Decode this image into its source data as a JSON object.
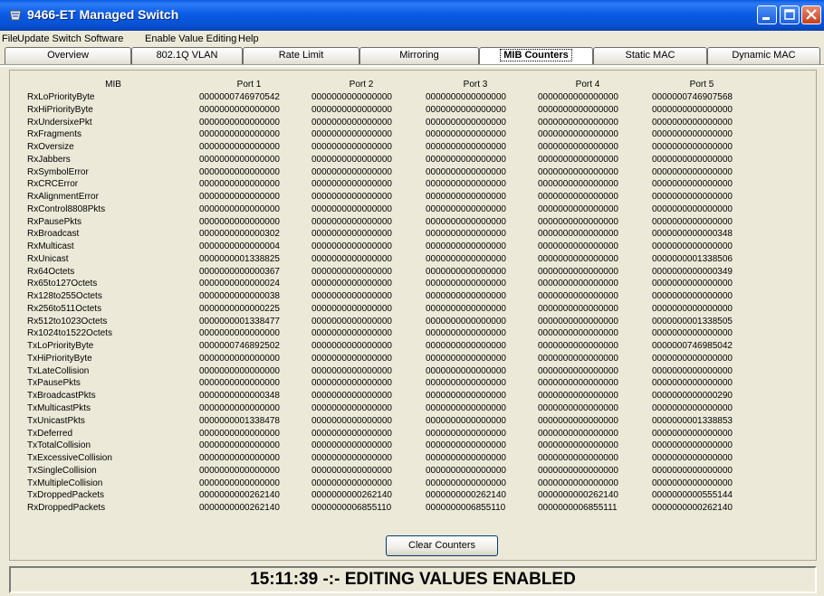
{
  "window": {
    "title": "9466-ET Managed Switch",
    "icon": "switch-app-icon",
    "controls": [
      "minimize-icon",
      "maximize-icon",
      "close-icon"
    ]
  },
  "menu": [
    "File",
    "Update Switch Software",
    "Enable Value Editing",
    "Help"
  ],
  "tabs": [
    {
      "label": "Overview",
      "active": false
    },
    {
      "label": "802.1Q VLAN",
      "active": false
    },
    {
      "label": "Rate Limit",
      "active": false
    },
    {
      "label": "Mirroring",
      "active": false
    },
    {
      "label": "MIB Counters",
      "active": true
    },
    {
      "label": "Static MAC",
      "active": false
    },
    {
      "label": "Dynamic MAC",
      "active": false
    }
  ],
  "table": {
    "headers": [
      "MIB",
      "Port 1",
      "Port 2",
      "Port 3",
      "Port 4",
      "Port 5"
    ],
    "rows": [
      [
        "RxLoPriorityByte",
        "0000000746970542",
        "0000000000000000",
        "0000000000000000",
        "0000000000000000",
        "0000000746907568"
      ],
      [
        "RxHiPriorityByte",
        "0000000000000000",
        "0000000000000000",
        "0000000000000000",
        "0000000000000000",
        "0000000000000000"
      ],
      [
        "RxUndersixePkt",
        "0000000000000000",
        "0000000000000000",
        "0000000000000000",
        "0000000000000000",
        "0000000000000000"
      ],
      [
        "RxFragments",
        "0000000000000000",
        "0000000000000000",
        "0000000000000000",
        "0000000000000000",
        "0000000000000000"
      ],
      [
        "RxOversize",
        "0000000000000000",
        "0000000000000000",
        "0000000000000000",
        "0000000000000000",
        "0000000000000000"
      ],
      [
        "RxJabbers",
        "0000000000000000",
        "0000000000000000",
        "0000000000000000",
        "0000000000000000",
        "0000000000000000"
      ],
      [
        "RxSymbolError",
        "0000000000000000",
        "0000000000000000",
        "0000000000000000",
        "0000000000000000",
        "0000000000000000"
      ],
      [
        "RxCRCError",
        "0000000000000000",
        "0000000000000000",
        "0000000000000000",
        "0000000000000000",
        "0000000000000000"
      ],
      [
        "RxAlignmentError",
        "0000000000000000",
        "0000000000000000",
        "0000000000000000",
        "0000000000000000",
        "0000000000000000"
      ],
      [
        "RxControl8808Pkts",
        "0000000000000000",
        "0000000000000000",
        "0000000000000000",
        "0000000000000000",
        "0000000000000000"
      ],
      [
        "RxPausePkts",
        "0000000000000000",
        "0000000000000000",
        "0000000000000000",
        "0000000000000000",
        "0000000000000000"
      ],
      [
        "RxBroadcast",
        "0000000000000302",
        "0000000000000000",
        "0000000000000000",
        "0000000000000000",
        "0000000000000348"
      ],
      [
        "RxMulticast",
        "0000000000000004",
        "0000000000000000",
        "0000000000000000",
        "0000000000000000",
        "0000000000000000"
      ],
      [
        "RxUnicast",
        "0000000001338825",
        "0000000000000000",
        "0000000000000000",
        "0000000000000000",
        "0000000001338506"
      ],
      [
        "Rx64Octets",
        "0000000000000367",
        "0000000000000000",
        "0000000000000000",
        "0000000000000000",
        "0000000000000349"
      ],
      [
        "Rx65to127Octets",
        "0000000000000024",
        "0000000000000000",
        "0000000000000000",
        "0000000000000000",
        "0000000000000000"
      ],
      [
        "Rx128to255Octets",
        "0000000000000038",
        "0000000000000000",
        "0000000000000000",
        "0000000000000000",
        "0000000000000000"
      ],
      [
        "Rx256to511Octets",
        "0000000000000225",
        "0000000000000000",
        "0000000000000000",
        "0000000000000000",
        "0000000000000000"
      ],
      [
        "Rx512to1023Octets",
        "0000000001338477",
        "0000000000000000",
        "0000000000000000",
        "0000000000000000",
        "0000000001338505"
      ],
      [
        "Rx1024to1522Octets",
        "0000000000000000",
        "0000000000000000",
        "0000000000000000",
        "0000000000000000",
        "0000000000000000"
      ],
      [
        "TxLoPriorityByte",
        "0000000746892502",
        "0000000000000000",
        "0000000000000000",
        "0000000000000000",
        "0000000746985042"
      ],
      [
        "TxHiPriorityByte",
        "0000000000000000",
        "0000000000000000",
        "0000000000000000",
        "0000000000000000",
        "0000000000000000"
      ],
      [
        "TxLateCollision",
        "0000000000000000",
        "0000000000000000",
        "0000000000000000",
        "0000000000000000",
        "0000000000000000"
      ],
      [
        "TxPausePkts",
        "0000000000000000",
        "0000000000000000",
        "0000000000000000",
        "0000000000000000",
        "0000000000000000"
      ],
      [
        "TxBroadcastPkts",
        "0000000000000348",
        "0000000000000000",
        "0000000000000000",
        "0000000000000000",
        "0000000000000290"
      ],
      [
        "TxMulticastPkts",
        "0000000000000000",
        "0000000000000000",
        "0000000000000000",
        "0000000000000000",
        "0000000000000000"
      ],
      [
        "TxUnicastPkts",
        "0000000001338478",
        "0000000000000000",
        "0000000000000000",
        "0000000000000000",
        "0000000001338853"
      ],
      [
        "TxDeferred",
        "0000000000000000",
        "0000000000000000",
        "0000000000000000",
        "0000000000000000",
        "0000000000000000"
      ],
      [
        "TxTotalCollision",
        "0000000000000000",
        "0000000000000000",
        "0000000000000000",
        "0000000000000000",
        "0000000000000000"
      ],
      [
        "TxExcessiveCollision",
        "0000000000000000",
        "0000000000000000",
        "0000000000000000",
        "0000000000000000",
        "0000000000000000"
      ],
      [
        "TxSingleCollision",
        "0000000000000000",
        "0000000000000000",
        "0000000000000000",
        "0000000000000000",
        "0000000000000000"
      ],
      [
        "TxMultipleCollision",
        "0000000000000000",
        "0000000000000000",
        "0000000000000000",
        "0000000000000000",
        "0000000000000000"
      ],
      [
        "TxDroppedPackets",
        "0000000000262140",
        "0000000000262140",
        "0000000000262140",
        "0000000000262140",
        "0000000000555144"
      ],
      [
        "RxDroppedPackets",
        "0000000000262140",
        "0000000006855110",
        "0000000006855110",
        "0000000006855111",
        "0000000000262140"
      ]
    ]
  },
  "clear_button": "Clear Counters",
  "status": "15:11:39 -:- EDITING VALUES ENABLED",
  "colors": {
    "titlebar": "#0a58e0",
    "window_bg": "#ece9d8",
    "close_button": "#c5401e"
  }
}
